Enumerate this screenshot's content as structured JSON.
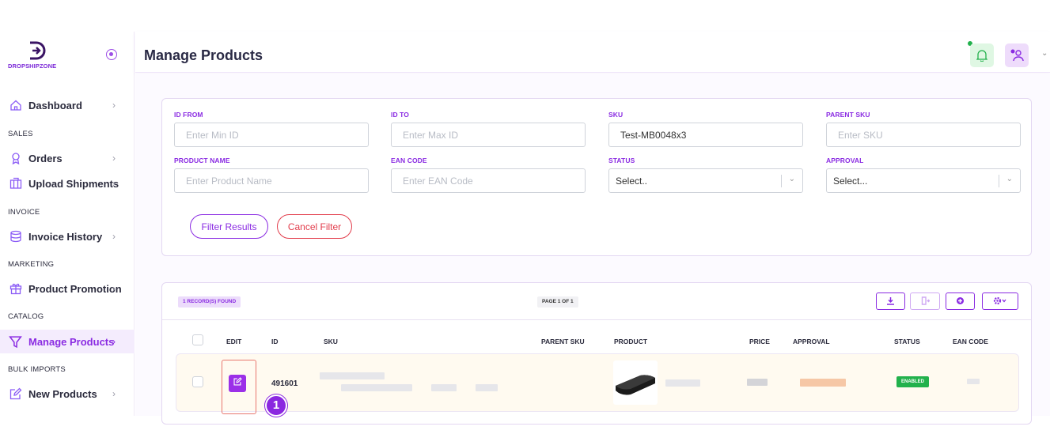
{
  "brand": {
    "logo_text": "DROPSHIPZONE"
  },
  "sidebar": {
    "items": [
      {
        "label": "Dashboard"
      },
      {
        "section": "SALES"
      },
      {
        "label": "Orders"
      },
      {
        "label": "Upload Shipments"
      },
      {
        "section": "INVOICE"
      },
      {
        "label": "Invoice History"
      },
      {
        "section": "MARKETING"
      },
      {
        "label": "Product Promotion"
      },
      {
        "section": "CATALOG"
      },
      {
        "label": "Manage Products",
        "active": true
      },
      {
        "section": "BULK IMPORTS"
      },
      {
        "label": "New Products"
      }
    ]
  },
  "header": {
    "title": "Manage Products"
  },
  "filters": {
    "id_from": {
      "label": "ID FROM",
      "placeholder": "Enter Min ID",
      "value": ""
    },
    "id_to": {
      "label": "ID TO",
      "placeholder": "Enter Max ID",
      "value": ""
    },
    "sku": {
      "label": "SKU",
      "placeholder": "",
      "value": "Test-MB0048x3"
    },
    "parent_sku": {
      "label": "PARENT SKU",
      "placeholder": "Enter SKU",
      "value": ""
    },
    "product_name": {
      "label": "PRODUCT NAME",
      "placeholder": "Enter Product Name",
      "value": ""
    },
    "ean_code": {
      "label": "EAN CODE",
      "placeholder": "Enter EAN Code",
      "value": ""
    },
    "status": {
      "label": "STATUS",
      "selected": "Select.."
    },
    "approval": {
      "label": "APPROVAL",
      "selected": "Select..."
    },
    "filter_button": "Filter Results",
    "cancel_button": "Cancel Filter"
  },
  "table": {
    "records_found": "1 RECORD(S) FOUND",
    "page_info": "PAGE 1 OF 1",
    "columns": [
      "EDIT",
      "ID",
      "SKU",
      "PARENT SKU",
      "PRODUCT",
      "PRICE",
      "APPROVAL",
      "STATUS",
      "EAN CODE"
    ],
    "rows": [
      {
        "id": "491601",
        "status": "ENABLED"
      }
    ],
    "step_marker": "1"
  },
  "colors": {
    "accent": "#8a2be2",
    "danger": "#e23c4b",
    "success": "#22b14c"
  }
}
